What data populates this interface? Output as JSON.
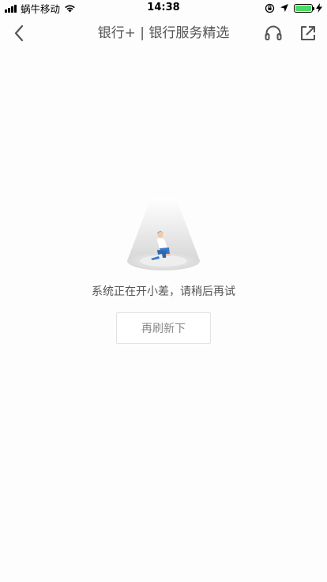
{
  "status_bar": {
    "carrier": "蜗牛移动",
    "time": "14:38",
    "battery_level": 1.0,
    "battery_color": "#4cd964"
  },
  "nav": {
    "title": "银行+ | 银行服务精选",
    "back_icon": "chevron-left-icon",
    "service_icon": "headset-icon",
    "share_icon": "external-share-icon"
  },
  "empty_state": {
    "illustration": "person-sitting-in-spotlight",
    "message": "系统正在开小差，请稍后再试",
    "button_label": "再刷新下"
  },
  "colors": {
    "background": "#fdfdfd",
    "text_primary": "#555555",
    "button_text": "#888888",
    "button_border": "#e2e2e2",
    "figure_shirt": "#ffffff",
    "figure_pants": "#3a78c9"
  }
}
